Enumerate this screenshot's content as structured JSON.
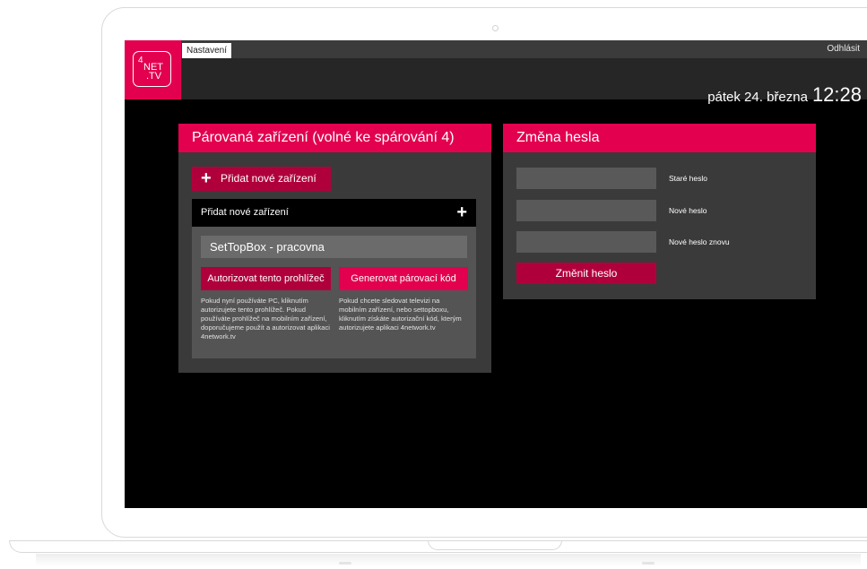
{
  "app": {
    "tab_label": "Nastavení",
    "logout_label": "Odhlásit",
    "logo": {
      "line1": "4",
      "line2": "NET",
      "line3": ".TV"
    },
    "date": "pátek 24. března",
    "time": "12:28",
    "brand_color": "#e3004f",
    "accent_dark": "#b0003c"
  },
  "paired_devices": {
    "title": "Párovaná zařízení (volné ke spárování 4)",
    "add_button_label": "Přidat nové zařízení",
    "add_section_label": "Přidat nové zařízení",
    "device_name_value": "SetTopBox - pracovna",
    "authorize_button_label": "Autorizovat tento prohlížeč",
    "generate_code_button_label": "Generovat párovací kód",
    "authorize_help": "Pokud nyní používáte PC, kliknutím autorizujete tento prohlížeč. Pokud používáte prohlížeč na mobilním zařízení, doporučujeme použít a autorizovat aplikaci 4network.tv",
    "generate_help": "Pokud chcete sledovat televizi na mobilním zařízení, nebo settopboxu, kliknutím získáte autorizační kód, kterým autorizujete aplikaci 4network.tv",
    "add_icon": "plus-icon"
  },
  "password_change": {
    "title": "Změna hesla",
    "old_password_label": "Staré heslo",
    "new_password_label": "Nové heslo",
    "new_password_again_label": "Nové heslo znovu",
    "submit_label": "Změnit heslo"
  }
}
